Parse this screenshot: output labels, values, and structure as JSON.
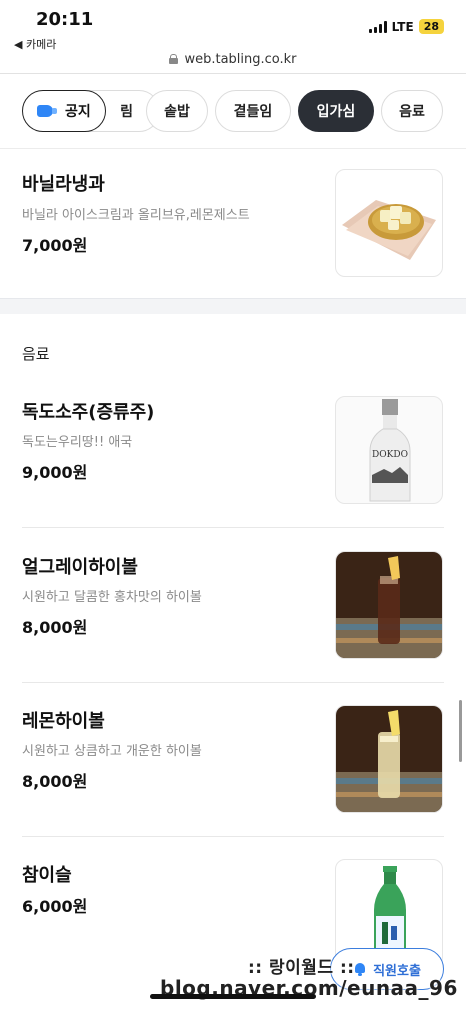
{
  "status": {
    "time": "20:11",
    "back_app": "◀ 카메라",
    "network": "LTE",
    "battery": "28"
  },
  "browser": {
    "url": "web.tabling.co.kr"
  },
  "tabs": {
    "notice": "공지",
    "items": [
      "림",
      "솥밥",
      "곁들임",
      "입가심",
      "음료"
    ],
    "active": "입가심"
  },
  "items_top": [
    {
      "name": "바닐라냉과",
      "desc": "바닐라 아이스크림과 올리브유,레몬제스트",
      "price": "7,000원",
      "image": "vanilla-dessert"
    }
  ],
  "section": {
    "title": "음료"
  },
  "drinks": [
    {
      "name": "독도소주(증류주)",
      "desc": "독도는우리땅!! 애국",
      "price": "9,000원",
      "image": "dokdo-bottle",
      "bottle_label": "DOKDO"
    },
    {
      "name": "얼그레이하이볼",
      "desc": "시원하고 달콤한 홍차맛의 하이볼",
      "price": "8,000원",
      "image": "earlgrey-highball"
    },
    {
      "name": "레몬하이볼",
      "desc": "시원하고 상큼하고 개운한 하이볼",
      "price": "8,000원",
      "image": "lemon-highball"
    },
    {
      "name": "참이슬",
      "desc": "",
      "price": "6,000원",
      "image": "chamisul-bottle"
    }
  ],
  "floating": {
    "call_staff": "직원호출"
  },
  "watermark": {
    "line1": ":: 랑이월드 ::",
    "line2": "blog.naver.com/eunaa_96"
  },
  "colors": {
    "active_tab": "#2b2f36",
    "accent_blue": "#2f86f6",
    "section_bg": "#f3f4f6"
  }
}
